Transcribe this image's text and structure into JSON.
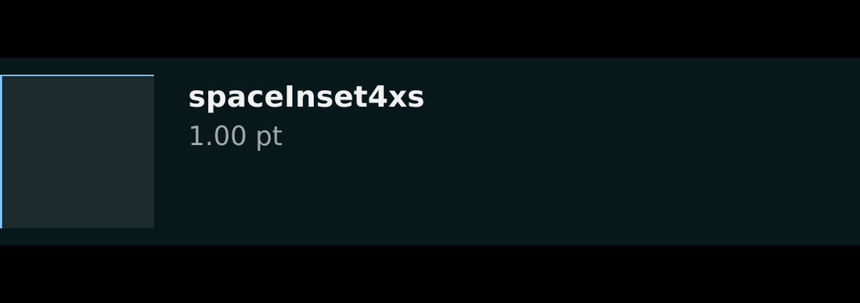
{
  "token": {
    "name": "spaceInset4xs",
    "value": "1.00 pt"
  },
  "colors": {
    "page_background": "#000000",
    "row_background": "#08171a",
    "swatch_fill": "#1c2a2b",
    "inset_edge": "#88c4ee",
    "name_text": "#f1f1f1",
    "value_text": "#a1a8aa"
  }
}
